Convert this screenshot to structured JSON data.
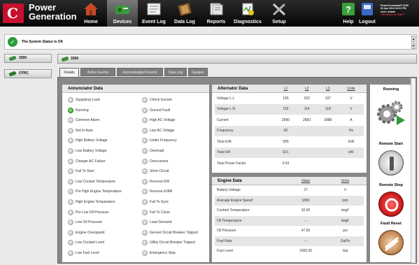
{
  "brand": {
    "line1": "Power",
    "line2": "Generation",
    "logo_glyph": "C"
  },
  "nav": [
    {
      "label": "Home",
      "icon": "home-icon"
    },
    {
      "label": "Devices",
      "icon": "devices-icon",
      "active": true
    },
    {
      "label": "Event Log",
      "icon": "event-log-icon"
    },
    {
      "label": "Data Log",
      "icon": "data-log-icon"
    },
    {
      "label": "Reports",
      "icon": "reports-icon"
    },
    {
      "label": "Diagnostics",
      "icon": "diagnostics-icon"
    },
    {
      "label": "Setup",
      "icon": "setup-icon"
    }
  ],
  "right_nav": [
    {
      "label": "Help",
      "icon": "help-icon"
    },
    {
      "label": "Logout",
      "icon": "logout-icon"
    }
  ],
  "sysinfo": {
    "line1": "PowerCommand® 3100",
    "line2": "04 Apr 2013 04:31 PM",
    "line3": "User: Admin",
    "tagline": "The Power of ONE™"
  },
  "status": {
    "text": "The System Status is OK"
  },
  "left_devices": [
    {
      "label": "3300"
    },
    {
      "label": "OTPC"
    }
  ],
  "device_tab": "3300",
  "tabs": [
    "Details",
    "Active Events",
    "Acknowledged Events",
    "Data Log",
    "Gauges"
  ],
  "annunciator": {
    "title": "Annunciator Data",
    "col1": [
      {
        "label": "Supplying Load",
        "on": false
      },
      {
        "label": "Running",
        "on": true
      },
      {
        "label": "Common Alarm",
        "on": false
      },
      {
        "label": "Not In Auto",
        "on": false
      },
      {
        "label": "High Battery Voltage",
        "on": false
      },
      {
        "label": "Low Battery Voltage",
        "on": false
      },
      {
        "label": "Charger AC Failure",
        "on": false
      },
      {
        "label": "Fail To Start",
        "on": false
      },
      {
        "label": "Low Coolant Temperature",
        "on": false
      },
      {
        "label": "Pre High Engine Temperature",
        "on": false
      },
      {
        "label": "High Engine Temperature",
        "on": false
      },
      {
        "label": "Pre Low Oil Pressure",
        "on": false
      },
      {
        "label": "Low Oil Pressure",
        "on": false
      },
      {
        "label": "Engine Overspeed",
        "on": false
      },
      {
        "label": "Low Coolant Level",
        "on": false
      },
      {
        "label": "Low Fuel Level",
        "on": false
      }
    ],
    "col2": [
      {
        "label": "Check Genset",
        "on": false
      },
      {
        "label": "Ground Fault",
        "on": false
      },
      {
        "label": "High AC Voltage",
        "on": false
      },
      {
        "label": "Low AC Voltage",
        "on": false
      },
      {
        "label": "Under Frequency",
        "on": false
      },
      {
        "label": "Overload",
        "on": false
      },
      {
        "label": "Overcurrent",
        "on": false
      },
      {
        "label": "Short Circuit",
        "on": false
      },
      {
        "label": "Reverse KW",
        "on": false
      },
      {
        "label": "Reverse kVAR",
        "on": false
      },
      {
        "label": "Fail To Sync",
        "on": false
      },
      {
        "label": "Fail To Close",
        "on": false
      },
      {
        "label": "Load Demand",
        "on": false
      },
      {
        "label": "Genset Circuit Breaker Tripped",
        "on": false
      },
      {
        "label": "Utility Circuit Breaker Tripped",
        "on": false
      },
      {
        "label": "Emergency Stop",
        "on": false
      }
    ]
  },
  "alternator": {
    "title": "Alternator Data",
    "headers": [
      "L1",
      "L2",
      "L3",
      "Units"
    ],
    "rows": [
      {
        "label": "Voltage L-L",
        "l1": "195",
        "l2": "202",
        "l3": "197",
        "units": "V"
      },
      {
        "label": "Voltage L-N",
        "l1": "115",
        "l2": "114",
        "l3": "118",
        "units": "V"
      },
      {
        "label": "Current",
        "l1": "2890",
        "l2": "2883",
        "l3": "2888",
        "units": "A"
      },
      {
        "label": "Frequency",
        "l1": "60",
        "l2": "",
        "l3": "",
        "units": "Hz"
      },
      {
        "label": "Total kVA",
        "l1": "995",
        "l2": "",
        "l3": "",
        "units": "kVA"
      },
      {
        "label": "Total kW",
        "l1": "621",
        "l2": "",
        "l3": "",
        "units": "kW"
      },
      {
        "label": "Total Power Factor",
        "l1": "0.63",
        "l2": "",
        "l3": "",
        "units": ""
      }
    ]
  },
  "engine": {
    "title": "Engine Data",
    "headers": [
      "Value",
      "Units"
    ],
    "rows": [
      {
        "label": "Battery Voltage",
        "value": "27",
        "units": "V"
      },
      {
        "label": "Average Engine Speed",
        "value": "1800",
        "units": "rpm"
      },
      {
        "label": "Coolant Temperature",
        "value": "32.00",
        "units": "degF"
      },
      {
        "label": "Oil Temperature",
        "value": "--",
        "units": "degF"
      },
      {
        "label": "Oil Pressure",
        "value": "47.60",
        "units": "psi"
      },
      {
        "label": "Fuel Rate",
        "value": "--",
        "units": "Gal/hr"
      },
      {
        "label": "Fuel Level",
        "value": "1000.00",
        "units": "Gal"
      }
    ]
  },
  "controls": {
    "state": "Running",
    "remote_start": "Remote Start",
    "remote_stop": "Remote Stop",
    "fault_reset": "Fault Reset"
  }
}
